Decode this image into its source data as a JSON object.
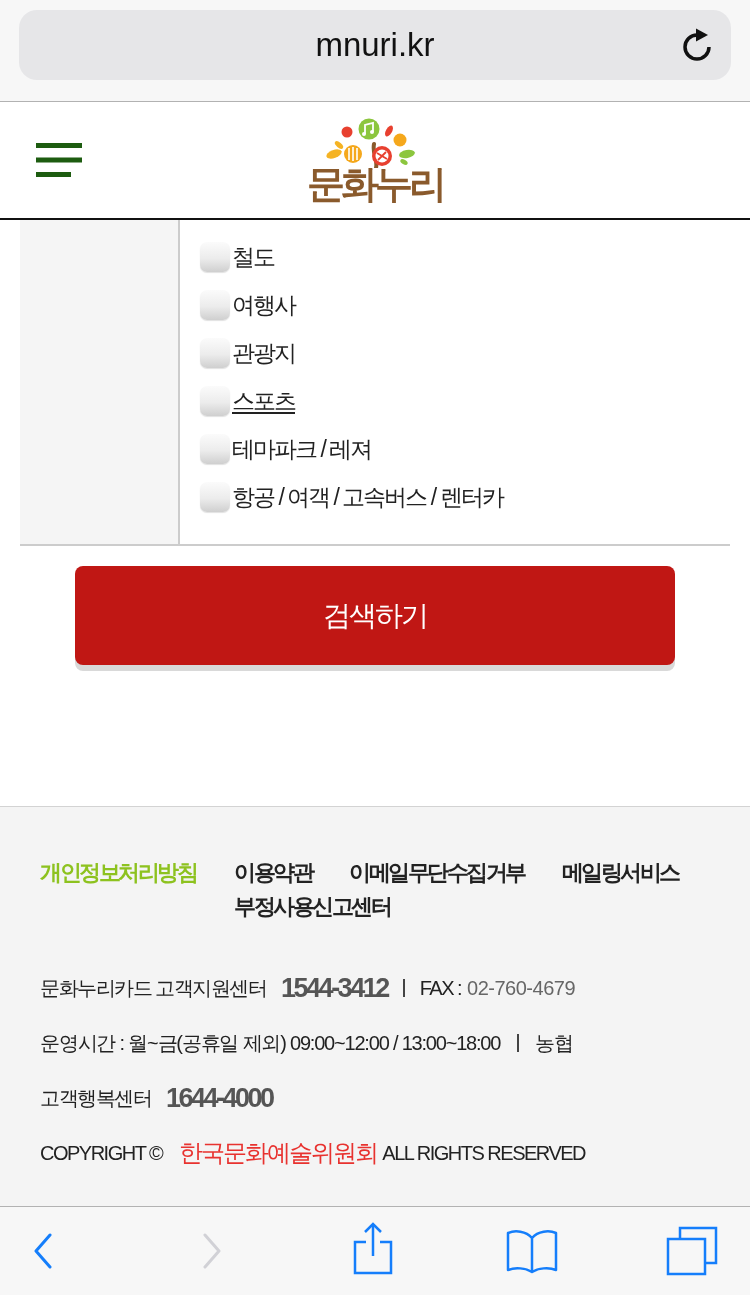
{
  "address_bar": {
    "url": "mnuri.kr"
  },
  "header": {
    "logo_text": "문화누리"
  },
  "category_options": [
    {
      "label": "철도",
      "checked": false,
      "underlined": false
    },
    {
      "label": "여행사",
      "checked": false,
      "underlined": false
    },
    {
      "label": "관광지",
      "checked": false,
      "underlined": false
    },
    {
      "label": "스포츠",
      "checked": false,
      "underlined": true
    },
    {
      "label": "테마파크 / 레져",
      "checked": false,
      "underlined": false
    },
    {
      "label": "항공 / 여객 / 고속버스 / 렌터카",
      "checked": false,
      "underlined": false
    }
  ],
  "search_button": {
    "label": "검색하기"
  },
  "footer": {
    "links": [
      {
        "label": "개인정보처리방침",
        "highlighted": true
      },
      {
        "label": "이용약관",
        "highlighted": false
      },
      {
        "label": "이메일무단수집거부",
        "highlighted": false
      },
      {
        "label": "메일링서비스",
        "highlighted": false
      },
      {
        "label": "부정사용신고센터",
        "highlighted": false
      }
    ],
    "support_center": {
      "label": "문화누리카드 고객지원센터",
      "phone": "1544-3412",
      "fax_label": "FAX :",
      "fax": "02-760-4679"
    },
    "hours": {
      "text": "운영시간 : 월~금(공휴일 제외) 09:00~12:00 / 13:00~18:00",
      "bank": "농협"
    },
    "happiness_center": {
      "label": "고객행복센터",
      "phone": "1644-4000"
    },
    "copyright": {
      "prefix": "COPYRIGHT ©",
      "owner": "한국문화예술위원회",
      "suffix": "ALL RIGHTS RESERVED"
    }
  },
  "toolbar": [
    {
      "kind": "back",
      "disabled": false
    },
    {
      "kind": "forward",
      "disabled": true
    },
    {
      "kind": "share",
      "disabled": false
    },
    {
      "kind": "bookmarks",
      "disabled": false
    },
    {
      "kind": "tabs",
      "disabled": false
    }
  ]
}
